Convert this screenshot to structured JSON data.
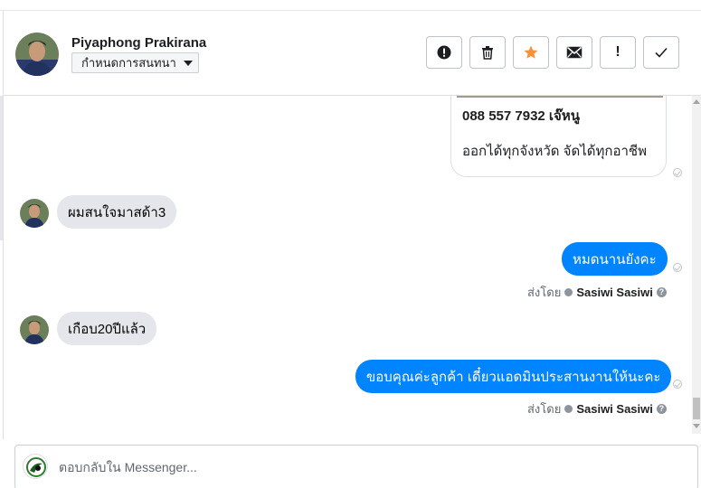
{
  "header": {
    "contact_name": "Piyaphong Prakirana",
    "assign_label": "กำหนดการสนทนา",
    "actions": [
      {
        "icon": "alert-circle-icon"
      },
      {
        "icon": "trash-icon"
      },
      {
        "icon": "star-icon",
        "color": "#f7923b"
      },
      {
        "icon": "envelope-icon"
      },
      {
        "icon": "exclamation-icon",
        "label": "!"
      },
      {
        "icon": "checkmark-icon"
      }
    ]
  },
  "messages": {
    "card": {
      "title": "088 557 7932 เจ๊หนู",
      "description": "ออกได้ทุกจังหวัด จัดได้ทุกอาชีพ"
    },
    "incoming_1": "ผมสนใจมาสด้า3",
    "outgoing_1": "หมดนานยังคะ",
    "sent_by_1": {
      "prefix": "ส่งโดย",
      "sender": "Sasiwi Sasiwi",
      "help": "?"
    },
    "incoming_2": "เกือบ20ปีแล้ว",
    "outgoing_2": "ขอบคุณค่ะลูกค้า เดี๋ยวแอดมินประสานงานให้นะคะ",
    "sent_by_2": {
      "prefix": "ส่งโดย",
      "sender": "Sasiwi Sasiwi",
      "help": "?"
    }
  },
  "composer": {
    "placeholder": "ตอบกลับใน Messenger..."
  },
  "colors": {
    "outgoing_bubble": "#0084ff",
    "incoming_bubble": "#e4e6eb",
    "star": "#f7923b"
  }
}
